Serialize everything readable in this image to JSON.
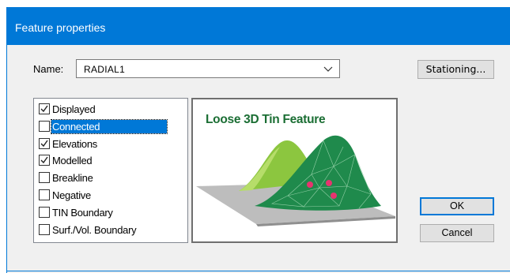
{
  "dialog": {
    "title": "Feature properties"
  },
  "name_field": {
    "label": "Name:",
    "value": "RADIAL1"
  },
  "buttons": {
    "stationing": "Stationing...",
    "ok": "OK",
    "cancel": "Cancel"
  },
  "properties": [
    {
      "label": "Displayed",
      "checked": true,
      "selected": false
    },
    {
      "label": "Connected",
      "checked": false,
      "selected": true
    },
    {
      "label": "Elevations",
      "checked": true,
      "selected": false
    },
    {
      "label": "Modelled",
      "checked": true,
      "selected": false
    },
    {
      "label": "Breakline",
      "checked": false,
      "selected": false
    },
    {
      "label": "Negative",
      "checked": false,
      "selected": false
    },
    {
      "label": "TIN Boundary",
      "checked": false,
      "selected": false
    },
    {
      "label": "Surf./Vol. Boundary",
      "checked": false,
      "selected": false
    }
  ],
  "preview": {
    "title": "Loose 3D Tin Feature"
  },
  "colors": {
    "titlebar": "#0078d7",
    "selection": "#0078d7",
    "preview_title": "#1b6e34",
    "dark_mound": "#1f8a4c",
    "light_mound": "#8cc63f",
    "base_plane": "#b5b5b5",
    "points": "#e8336f"
  }
}
